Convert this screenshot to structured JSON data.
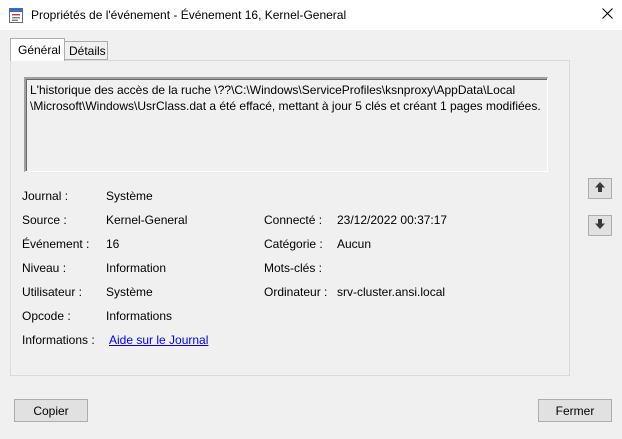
{
  "window": {
    "title": "Propriétés de l'événement - Événement 16, Kernel-General",
    "icon": "event-properties-icon",
    "close_icon": "close-icon"
  },
  "tabs": [
    {
      "label": "Général",
      "selected": true
    },
    {
      "label": "Détails",
      "selected": false
    }
  ],
  "description": "L'historique des accès de la ruche \\??\\C:\\Windows\\ServiceProfiles\\ksnproxy\\AppData\\Local\n\\Microsoft\\Windows\\UsrClass.dat a été effacé, mettant à jour 5 clés et créant 1 pages modifiées.",
  "fields": {
    "journal": {
      "label": "Journal :",
      "value": "Système"
    },
    "source": {
      "label": "Source :",
      "value": "Kernel-General"
    },
    "evenement": {
      "label": "Événement :",
      "value": "16"
    },
    "niveau": {
      "label": "Niveau :",
      "value": "Information"
    },
    "utilisateur": {
      "label": "Utilisateur :",
      "value": "Système"
    },
    "opcode": {
      "label": "Opcode :",
      "value": "Informations"
    },
    "informations": {
      "label": "Informations :",
      "value": "Aide sur le Journal"
    },
    "connecte": {
      "label": "Connecté :",
      "value": "23/12/2022 00:37:17"
    },
    "categorie": {
      "label": "Catégorie :",
      "value": "Aucun"
    },
    "mots_cles": {
      "label": "Mots-clés :",
      "value": ""
    },
    "ordinateur": {
      "label": "Ordinateur :",
      "value": "srv-cluster.ansi.local"
    }
  },
  "navigation": {
    "up_icon": "arrow-up-icon",
    "down_icon": "arrow-down-icon"
  },
  "buttons": {
    "copy": "Copier",
    "close": "Fermer"
  },
  "colors": {
    "link": "#0000ee",
    "window_bg": "#f0f0f0",
    "titlebar_bg": "#ffffff"
  }
}
